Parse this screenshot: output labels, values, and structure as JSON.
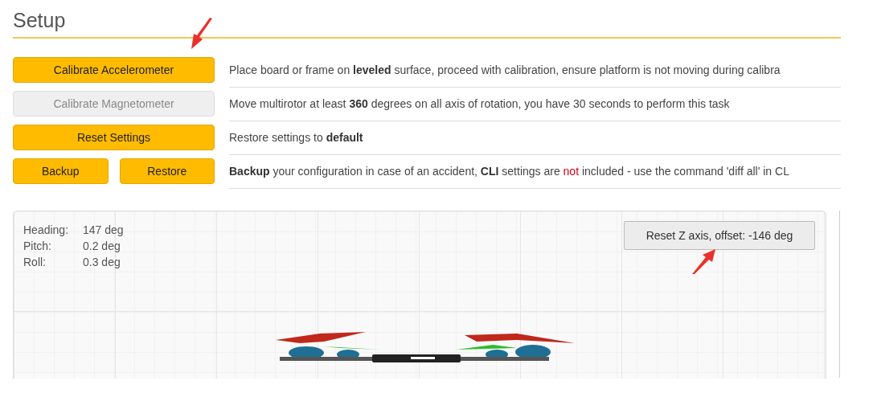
{
  "page": {
    "title": "Setup"
  },
  "rows": [
    {
      "buttons": [
        {
          "label": "Calibrate Accelerometer",
          "disabled": false
        }
      ],
      "description": [
        {
          "text": "Place board or frame on ",
          "kind": "plain"
        },
        {
          "text": "leveled",
          "kind": "bold"
        },
        {
          "text": " surface, proceed with calibration, ensure platform is not moving during calibra",
          "kind": "plain"
        }
      ]
    },
    {
      "buttons": [
        {
          "label": "Calibrate Magnetometer",
          "disabled": true
        }
      ],
      "description": [
        {
          "text": "Move multirotor at least ",
          "kind": "plain"
        },
        {
          "text": "360",
          "kind": "bold"
        },
        {
          "text": " degrees on all axis of rotation, you have 30 seconds to perform this task",
          "kind": "plain"
        }
      ]
    },
    {
      "buttons": [
        {
          "label": "Reset Settings",
          "disabled": false
        }
      ],
      "description": [
        {
          "text": "Restore settings to ",
          "kind": "plain"
        },
        {
          "text": "default",
          "kind": "bold"
        }
      ]
    },
    {
      "buttons": [
        {
          "label": "Backup",
          "disabled": false
        },
        {
          "label": "Restore",
          "disabled": false
        }
      ],
      "description": [
        {
          "text": "Backup",
          "kind": "bold"
        },
        {
          "text": " your configuration in case of an accident, ",
          "kind": "plain"
        },
        {
          "text": "CLI",
          "kind": "bold"
        },
        {
          "text": " settings are ",
          "kind": "plain"
        },
        {
          "text": "not",
          "kind": "warning"
        },
        {
          "text": " included - use the command 'diff all' in CL",
          "kind": "plain"
        }
      ]
    }
  ],
  "model_view": {
    "attitude": [
      {
        "label": "Heading:",
        "value": "147 deg"
      },
      {
        "label": "Pitch:",
        "value": "0.2 deg"
      },
      {
        "label": "Roll:",
        "value": "0.3 deg"
      }
    ],
    "reset_button": "Reset Z axis, offset: -146 deg"
  }
}
